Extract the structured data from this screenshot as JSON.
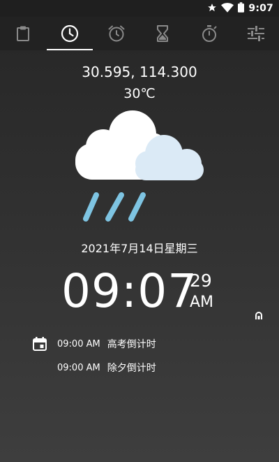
{
  "status_bar": {
    "time": "9:07",
    "icons": [
      "star-icon",
      "wifi-icon",
      "battery-icon"
    ]
  },
  "tabs": [
    {
      "name": "clipboard-icon",
      "active": false
    },
    {
      "name": "clock-icon",
      "active": true
    },
    {
      "name": "alarm-clock-icon",
      "active": false
    },
    {
      "name": "hourglass-icon",
      "active": false
    },
    {
      "name": "stopwatch-icon",
      "active": false
    },
    {
      "name": "sliders-icon",
      "active": false
    }
  ],
  "weather": {
    "coordinates": "30.595, 114.300",
    "temperature": "30℃",
    "icon": "rain-cloud-icon"
  },
  "date": "2021年7月14日星期三",
  "clock": {
    "time": "09:07",
    "seconds": "29",
    "ampm": "AM"
  },
  "events": [
    {
      "time": "09:00 AM",
      "title": "高考倒计时"
    },
    {
      "time": "09:00 AM",
      "title": "除夕倒计时"
    }
  ],
  "colors": {
    "background_top": "#262626",
    "background_bottom": "#3e3e3e",
    "tab_bar": "#222222",
    "icon_gray": "#8a8a8a",
    "rain": "#7ec4e2",
    "cloud_front": "#dbeaf6"
  }
}
